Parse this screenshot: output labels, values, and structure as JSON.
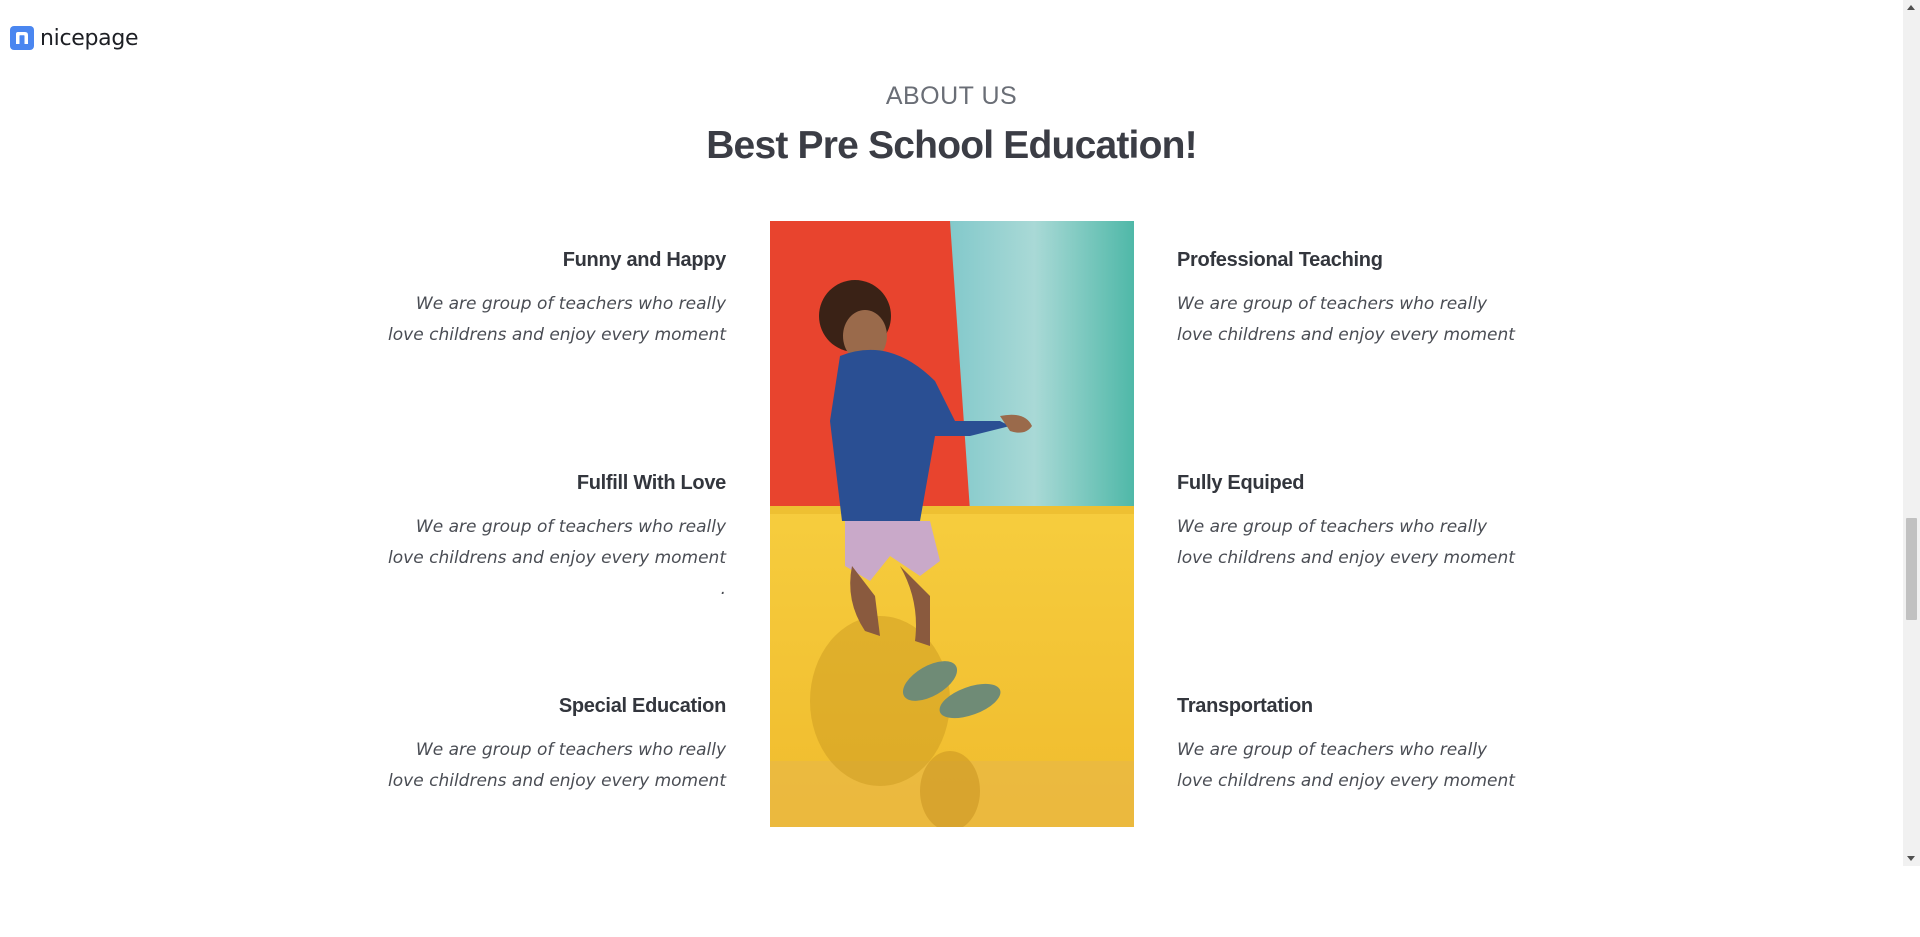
{
  "brand": {
    "name": "nicepage",
    "logo_icon": "nicepage-logo-icon",
    "accent": "#4a86f0"
  },
  "about": {
    "eyebrow": "ABOUT US",
    "headline": "Best Pre School Education!"
  },
  "features_left": [
    {
      "title": "Funny and Happy",
      "text": "We are group of teachers who really love childrens and enjoy every moment"
    },
    {
      "title": "Fulfill With Love",
      "text": "We are group of teachers who really love childrens and enjoy every moment ."
    },
    {
      "title": "Special Education",
      "text": "We are group of teachers who really love childrens and enjoy every moment"
    }
  ],
  "features_right": [
    {
      "title": "Professional Teaching",
      "text": "We are group of teachers who really love childrens and enjoy every moment"
    },
    {
      "title": "Fully Equiped",
      "text": "We are group of teachers who really love childrens and enjoy every moment"
    },
    {
      "title": "Transportation",
      "text": "We are group of teachers who really love childrens and enjoy every moment"
    }
  ],
  "photo": {
    "subject": "child-jumping-photo",
    "colors": {
      "red_wall": "#e8442e",
      "teal_wall": "#6cc3c4",
      "yellow_floor": "#f3c233",
      "shirt": "#2a4f93"
    }
  }
}
